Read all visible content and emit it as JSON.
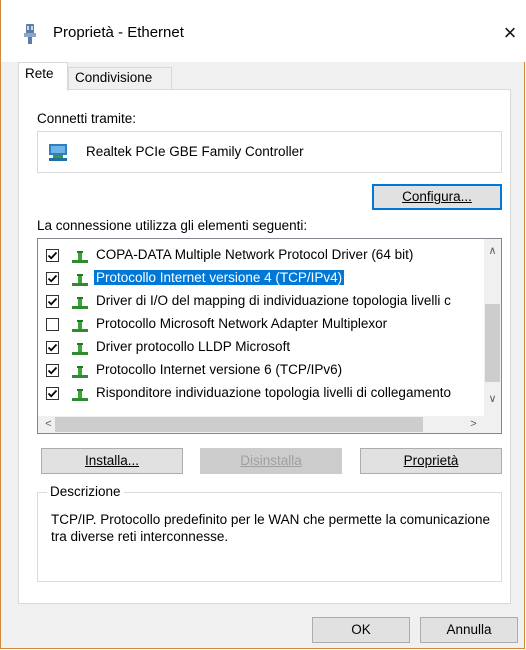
{
  "window": {
    "title": "Proprietà - Ethernet",
    "close_symbol": "×"
  },
  "tabs": [
    {
      "label": "Rete",
      "active": true
    },
    {
      "label": "Condivisione",
      "active": false
    }
  ],
  "connect_via": {
    "label": "Connetti tramite:",
    "adapter_name": "Realtek PCIe GBE Family Controller",
    "adapter_icon": "network-adapter-icon"
  },
  "configure_button": "Configura...",
  "items_label": "La connessione utilizza gli elementi seguenti:",
  "items": [
    {
      "label": "COPA-DATA Multiple Network Protocol Driver (64 bit)",
      "checked": true,
      "selected": false,
      "icon": "network-component-icon"
    },
    {
      "label": "Protocollo Internet versione 4 (TCP/IPv4)",
      "checked": true,
      "selected": true,
      "icon": "network-component-icon"
    },
    {
      "label": "Driver di I/O del mapping di individuazione topologia livelli c",
      "checked": true,
      "selected": false,
      "icon": "network-component-icon"
    },
    {
      "label": "Protocollo Microsoft Network Adapter Multiplexor",
      "checked": false,
      "selected": false,
      "icon": "network-component-icon"
    },
    {
      "label": "Driver protocollo LLDP Microsoft",
      "checked": true,
      "selected": false,
      "icon": "network-component-icon"
    },
    {
      "label": "Protocollo Internet versione 6 (TCP/IPv6)",
      "checked": true,
      "selected": false,
      "icon": "network-component-icon"
    },
    {
      "label": "Risponditore individuazione topologia livelli di collegamento",
      "checked": true,
      "selected": false,
      "icon": "network-component-icon"
    }
  ],
  "scroll_arrows": {
    "up": "∧",
    "down": "∨",
    "left": "<",
    "right": ">"
  },
  "buttons": {
    "install": "Installa...",
    "uninstall": "Disinstalla",
    "properties": "Proprietà",
    "ok": "OK",
    "cancel": "Annulla"
  },
  "description": {
    "title": "Descrizione",
    "text": "TCP/IP. Protocollo predefinito per le WAN che permette la comunicazione tra diverse reti interconnesse."
  },
  "colors": {
    "selection": "#0078d7",
    "focus_border": "#0078d7",
    "window_border": "#d08a3a"
  }
}
